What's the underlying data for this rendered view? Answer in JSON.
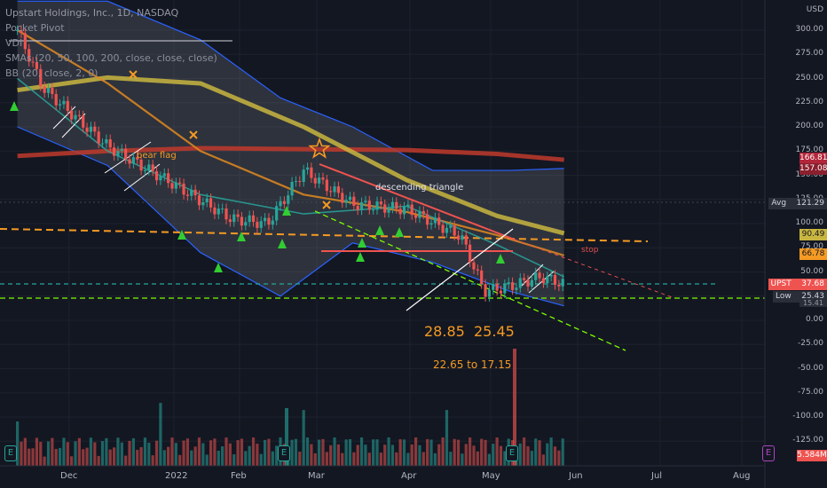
{
  "header": {
    "title": "Upstart Holdings, Inc., 1D, NASDAQ",
    "indicators": [
      "Pocket Pivot",
      "VDI",
      "SMAs (20, 50, 100, 200, close, close, close)",
      "BB (20, close, 2, 0)"
    ],
    "currency": "USD"
  },
  "annotations": {
    "target1": "28.85",
    "target2": "25.45",
    "range": "22.65  to  17.15",
    "pattern": "descending triangle",
    "bear_flag": "bear flag",
    "stop": "stop"
  },
  "price_tags": {
    "sma200": {
      "label": "",
      "value": "166.81",
      "color": "#b2263a"
    },
    "sma200b": {
      "label": "",
      "value": "157.08",
      "color": "#b2263a"
    },
    "avg": {
      "label": "Avg",
      "value": "121.29",
      "color": "#2a2e39"
    },
    "sma100": {
      "label": "",
      "value": "90.49",
      "color": "#c8b640"
    },
    "sma50": {
      "label": "",
      "value": "66.78",
      "color": "#f59a23"
    },
    "last": {
      "label": "UPST",
      "value": "37.68",
      "color": "#ef5350"
    },
    "low": {
      "label": "Low",
      "value": "25.43",
      "color": "#2a2e39"
    },
    "low2": {
      "label": "",
      "value": "15.41",
      "color": "#2a2e39"
    },
    "volume": {
      "label": "",
      "value": "5.584M",
      "color": "#ef5350"
    }
  },
  "chart_data": {
    "type": "line",
    "title": "Upstart Holdings, Inc., 1D, NASDAQ",
    "xlabel": "",
    "ylabel": "USD",
    "x_ticks": [
      "Dec",
      "2022",
      "Feb",
      "Mar",
      "Apr",
      "May",
      "Jun",
      "Jul",
      "Aug"
    ],
    "y_ticks": [
      300,
      275,
      250,
      225,
      200,
      175,
      150,
      125,
      100,
      75,
      50,
      25,
      0,
      -25,
      -50,
      -75,
      -100,
      -125
    ],
    "ylim": [
      -140,
      320
    ],
    "grid": true,
    "series": [
      {
        "name": "SMA 200",
        "color": "#c0392b",
        "x": [
          "2021-11-10",
          "2021-12-15",
          "2022-01-20",
          "2022-03-01",
          "2022-04-10",
          "2022-05-15",
          "2022-06-10"
        ],
        "y": [
          170,
          175,
          178,
          177,
          176,
          172,
          166
        ]
      },
      {
        "name": "SMA 100",
        "color": "#c8b640",
        "x": [
          "2021-11-10",
          "2021-12-15",
          "2022-01-20",
          "2022-03-01",
          "2022-04-10",
          "2022-05-15",
          "2022-06-10"
        ],
        "y": [
          238,
          251,
          245,
          200,
          145,
          108,
          90
        ]
      },
      {
        "name": "SMA 50",
        "color": "#e08a1e",
        "x": [
          "2021-11-10",
          "2021-12-15",
          "2022-01-20",
          "2022-03-01",
          "2022-04-10",
          "2022-05-15",
          "2022-06-10"
        ],
        "y": [
          300,
          245,
          175,
          130,
          112,
          88,
          67
        ]
      },
      {
        "name": "SMA 20",
        "color": "#26a69a",
        "x": [
          "2021-11-10",
          "2021-12-15",
          "2022-01-20",
          "2022-03-01",
          "2022-04-10",
          "2022-05-15",
          "2022-06-10"
        ],
        "y": [
          250,
          175,
          130,
          110,
          118,
          78,
          45
        ]
      },
      {
        "name": "Close",
        "color": "#ef5350",
        "x": [
          "2021-11-10",
          "2021-11-20",
          "2021-12-15",
          "2022-01-10",
          "2022-02-01",
          "2022-02-15",
          "2022-03-01",
          "2022-03-20",
          "2022-04-10",
          "2022-05-01",
          "2022-05-10",
          "2022-05-20",
          "2022-06-01",
          "2022-06-10"
        ],
        "y": [
          300,
          240,
          180,
          140,
          105,
          100,
          155,
          120,
          115,
          87,
          30,
          35,
          45,
          37.68
        ]
      }
    ],
    "bands": {
      "name": "BB (20, close, 2, 0)",
      "x": [
        "2021-11-10",
        "2021-12-15",
        "2022-01-20",
        "2022-02-20",
        "2022-03-20",
        "2022-04-20",
        "2022-05-20",
        "2022-06-10"
      ],
      "upper": [
        330,
        330,
        290,
        230,
        200,
        155,
        155,
        157
      ],
      "lower": [
        200,
        160,
        70,
        25,
        80,
        60,
        30,
        15
      ]
    },
    "levels": [
      {
        "name": "Avg",
        "y": 121.29
      },
      {
        "name": "Low",
        "y": 25.43
      }
    ],
    "volume": {
      "last": "5.584M"
    }
  },
  "x_axis_positions": [
    78,
    196,
    270,
    357,
    462,
    553,
    651,
    744,
    836
  ]
}
